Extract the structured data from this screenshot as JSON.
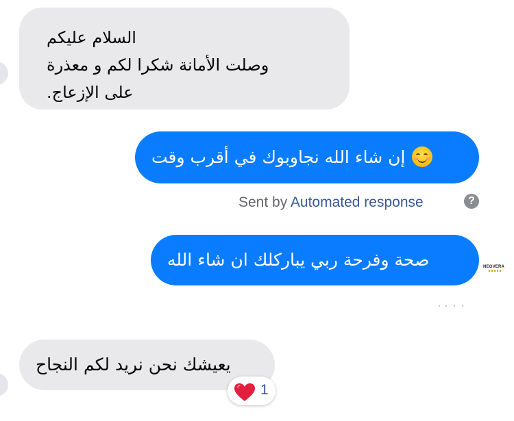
{
  "messages": [
    {
      "direction": "incoming",
      "lines": [
        "السلام عليكم",
        "وصلت الأمانة شكرا لكم و معذرة",
        "على الإزعاج."
      ]
    },
    {
      "direction": "outgoing",
      "emoji": "smiling-face-with-smiling-eyes",
      "text": "إن شاء الله نجاوبوك في أقرب وقت"
    },
    {
      "direction": "outgoing",
      "text": "صحة  وفرحة ربي يباركلك ان شاء الله"
    },
    {
      "direction": "incoming",
      "text": "يعيشك نحن نريد لكم النجاح",
      "reaction": {
        "icon": "heart-icon",
        "count": "1"
      }
    }
  ],
  "sent_by": {
    "prefix": "Sent by",
    "link": "Automated response",
    "help_icon": "?"
  },
  "read_receipt": {
    "avatar_text": "NEOVERA"
  },
  "colors": {
    "outgoing_bubble": "#0a7cff",
    "incoming_bubble": "#e9e9eb",
    "link": "#385898",
    "meta_text": "#65676b",
    "heart": "#e41e3f"
  }
}
